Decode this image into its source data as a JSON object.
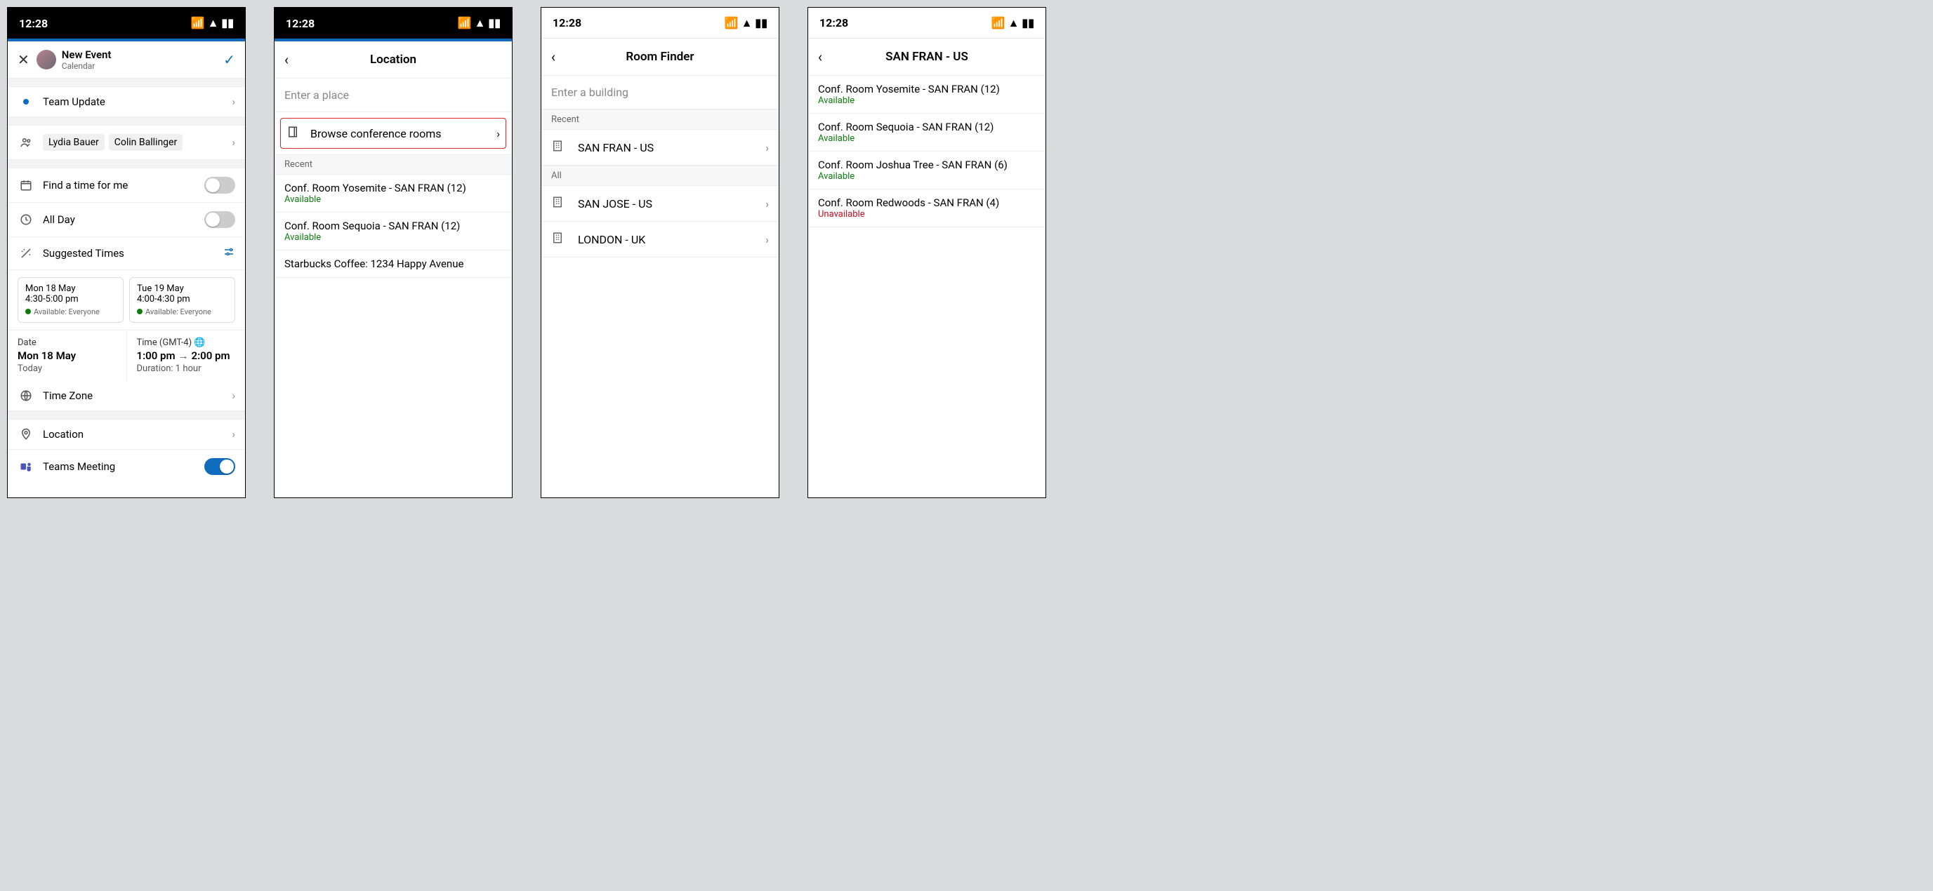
{
  "status": {
    "time": "12:28"
  },
  "screen1": {
    "header": {
      "title": "New Event",
      "subtitle": "Calendar"
    },
    "eventTitle": "Team Update",
    "invitees": [
      "Lydia Bauer",
      "Colin Ballinger"
    ],
    "findTime": "Find a time for me",
    "allDay": "All Day",
    "suggestedLabel": "Suggested Times",
    "suggestions": [
      {
        "d1": "Mon 18 May",
        "d2": "4:30-5:00 pm",
        "avail": "Available: Everyone"
      },
      {
        "d1": "Tue 19 May",
        "d2": "4:00-4:30 pm",
        "avail": "Available: Everyone"
      }
    ],
    "dateLabel": "Date",
    "dateValue": "Mon 18 May",
    "dateSub": "Today",
    "timeLabel": "Time (GMT-4)",
    "timeStart": "1:00 pm",
    "timeEnd": "2:00 pm",
    "timeSub": "Duration: 1 hour",
    "timezone": "Time Zone",
    "location": "Location",
    "teamsMeeting": "Teams Meeting"
  },
  "screen2": {
    "title": "Location",
    "placeholder": "Enter a place",
    "browse": "Browse conference rooms",
    "recentLabel": "Recent",
    "rooms": [
      {
        "name": "Conf. Room Yosemite - SAN FRAN (12)",
        "status": "Available",
        "cls": "a"
      },
      {
        "name": "Conf. Room Sequoia - SAN FRAN (12)",
        "status": "Available",
        "cls": "a"
      }
    ],
    "place": "Starbucks Coffee: 1234 Happy Avenue"
  },
  "screen3": {
    "title": "Room Finder",
    "placeholder": "Enter a building",
    "recentLabel": "Recent",
    "allLabel": "All",
    "recent": [
      "SAN FRAN - US"
    ],
    "all": [
      "SAN JOSE - US",
      "LONDON - UK"
    ]
  },
  "screen4": {
    "title": "SAN FRAN - US",
    "rooms": [
      {
        "name": "Conf. Room Yosemite - SAN FRAN (12)",
        "status": "Available",
        "cls": "a"
      },
      {
        "name": "Conf. Room Sequoia - SAN FRAN (12)",
        "status": "Available",
        "cls": "a"
      },
      {
        "name": "Conf. Room Joshua Tree - SAN FRAN (6)",
        "status": "Available",
        "cls": "a"
      },
      {
        "name": "Conf. Room Redwoods - SAN FRAN (4)",
        "status": "Unavailable",
        "cls": "u"
      }
    ]
  }
}
